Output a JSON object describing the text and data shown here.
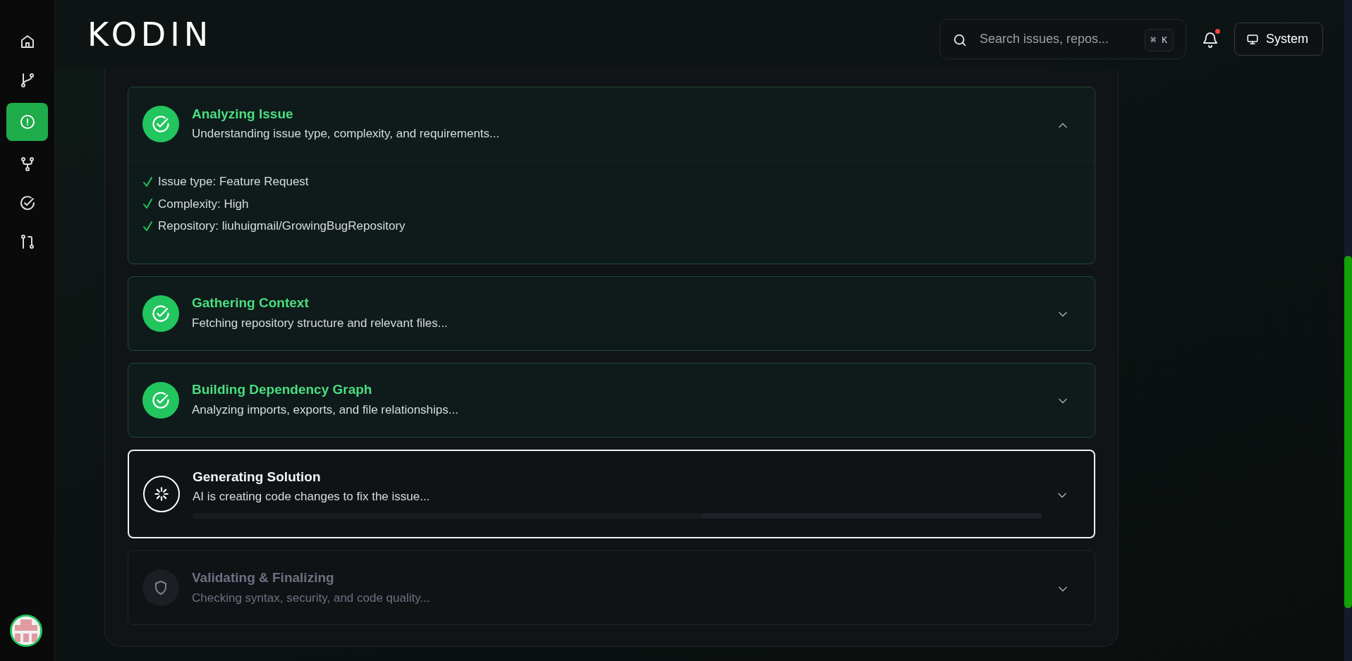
{
  "sidebar": {
    "items": [
      {
        "kind": "home",
        "selected": false
      },
      {
        "kind": "branch",
        "selected": false
      },
      {
        "kind": "issue",
        "selected": true
      },
      {
        "kind": "fork",
        "selected": false
      },
      {
        "kind": "check",
        "selected": false
      },
      {
        "kind": "pull",
        "selected": false
      }
    ]
  },
  "header": {
    "logo": "KODIN",
    "search": {
      "placeholder": "Search issues, repos...",
      "shortcut": "⌘ K"
    },
    "notifications": {
      "unread": true
    },
    "theme_button": "System"
  },
  "steps": [
    {
      "title": "Analyzing Issue",
      "description": "Understanding issue type, complexity, and requirements...",
      "kind": "done",
      "expanded": true,
      "details": [
        "Issue type: Feature Request",
        "Complexity: High",
        "Repository: liuhuigmail/GrowingBugRepository"
      ]
    },
    {
      "title": "Gathering Context",
      "description": "Fetching repository structure and relevant files...",
      "kind": "done",
      "expanded": false
    },
    {
      "title": "Building Dependency Graph",
      "description": "Analyzing imports, exports, and file relationships...",
      "kind": "done",
      "expanded": false
    },
    {
      "title": "Generating Solution",
      "description": "AI is creating code changes to fix the issue...",
      "kind": "active",
      "expanded": false,
      "level": 0.6
    },
    {
      "title": "Validating & Finalizing",
      "description": "Checking syntax, security, and code quality...",
      "kind": "pending",
      "expanded": false
    }
  ]
}
